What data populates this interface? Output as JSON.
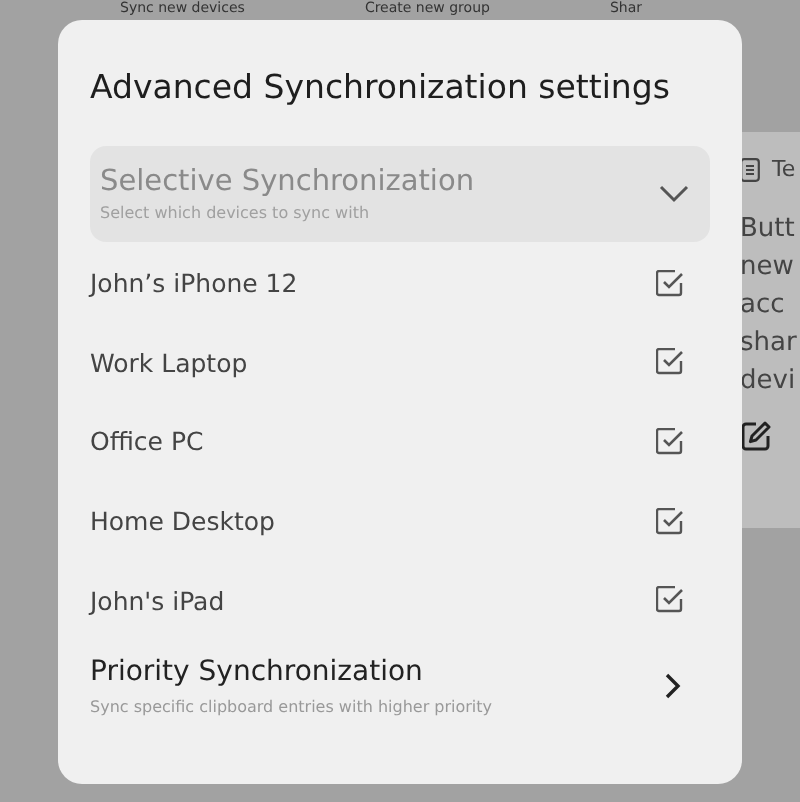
{
  "background": {
    "toolbar": [
      "Sync new devices",
      "Create new group",
      "Shar"
    ],
    "card": {
      "title": "Te",
      "lines": [
        "Butt",
        "new",
        "acc",
        "shar",
        "devi"
      ]
    }
  },
  "dialog": {
    "title": "Advanced Synchronization settings",
    "selective": {
      "title": "Selective Synchronization",
      "subtitle": "Select which devices to sync with",
      "expanded": true
    },
    "devices": [
      {
        "name": "John’s iPhone 12",
        "checked": true
      },
      {
        "name": "Work Laptop",
        "checked": true
      },
      {
        "name": "Office PC",
        "checked": true
      },
      {
        "name": "Home Desktop",
        "checked": true
      },
      {
        "name": "John's iPad",
        "checked": true
      }
    ],
    "priority": {
      "title": "Priority Synchronization",
      "subtitle": "Sync specific clipboard entries with higher priority"
    }
  }
}
